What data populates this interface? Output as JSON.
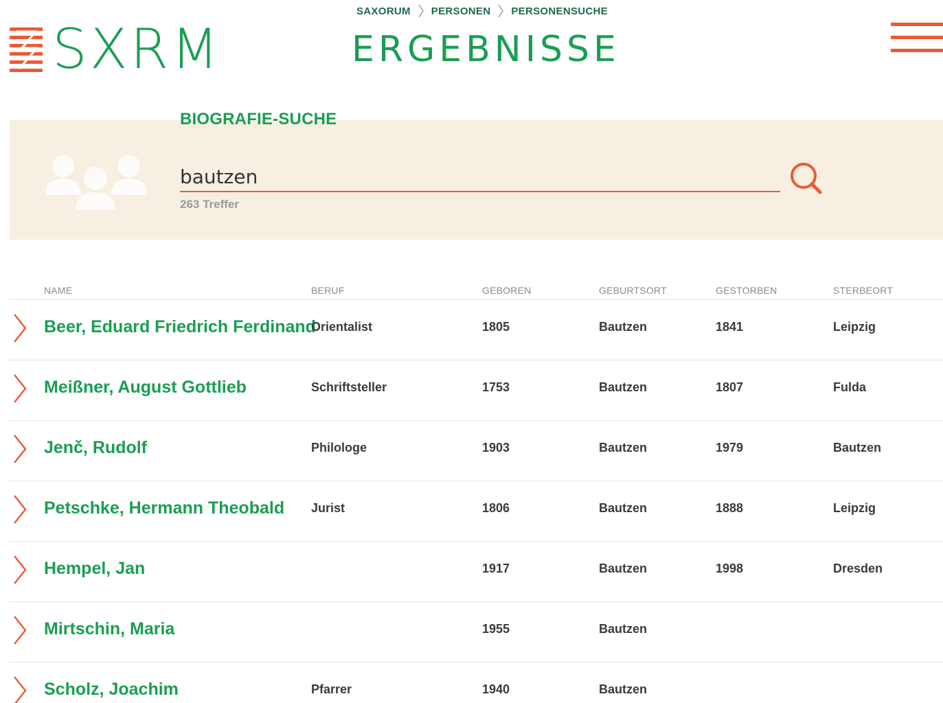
{
  "header": {
    "logo_text": "SXRM",
    "breadcrumb": [
      "SAXORUM",
      "PERSONEN",
      "PERSONENSUCHE"
    ],
    "page_title": "ERGEBNISSE"
  },
  "search": {
    "heading": "BIOGRAFIE-SUCHE",
    "query": "bautzen",
    "result_count": "263 Treffer"
  },
  "table": {
    "columns": [
      "NAME",
      "BERUF",
      "GEBOREN",
      "GEBURTSORT",
      "GESTORBEN",
      "STERBEORT"
    ],
    "rows": [
      {
        "name": "Beer, Eduard Friedrich Ferdinand",
        "beruf": "Orientalist",
        "geboren": "1805",
        "geburtsort": "Bautzen",
        "gestorben": "1841",
        "sterbeort": "Leipzig"
      },
      {
        "name": "Meißner, August Gottlieb",
        "beruf": "Schriftsteller",
        "geboren": "1753",
        "geburtsort": "Bautzen",
        "gestorben": "1807",
        "sterbeort": "Fulda"
      },
      {
        "name": "Jenč, Rudolf",
        "beruf": "Philologe",
        "geboren": "1903",
        "geburtsort": "Bautzen",
        "gestorben": "1979",
        "sterbeort": "Bautzen"
      },
      {
        "name": "Petschke, Hermann Theobald",
        "beruf": "Jurist",
        "geboren": "1806",
        "geburtsort": "Bautzen",
        "gestorben": "1888",
        "sterbeort": "Leipzig"
      },
      {
        "name": "Hempel, Jan",
        "beruf": "",
        "geboren": "1917",
        "geburtsort": "Bautzen",
        "gestorben": "1998",
        "sterbeort": "Dresden"
      },
      {
        "name": "Mirtschin, Maria",
        "beruf": "",
        "geboren": "1955",
        "geburtsort": "Bautzen",
        "gestorben": "",
        "sterbeort": ""
      },
      {
        "name": "Scholz, Joachim",
        "beruf": "Pfarrer",
        "geboren": "1940",
        "geburtsort": "Bautzen",
        "gestorben": "",
        "sterbeort": ""
      }
    ]
  },
  "colors": {
    "brand_green": "#1a9e52",
    "accent_orange": "#ec5a35",
    "panel_beige": "#f6efe2"
  },
  "icons": {
    "logo": "striped-flag-icon",
    "menu": "hamburger-menu-icon",
    "search": "search-icon",
    "people": "people-group-icon",
    "row": "chevron-right-icon",
    "breadcrumb": "chevron-separator-icon"
  }
}
